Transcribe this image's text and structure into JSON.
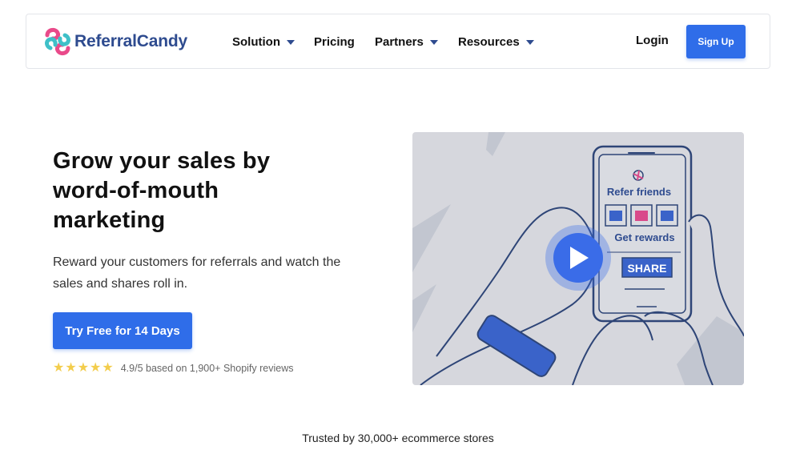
{
  "brand": {
    "name": "ReferralCandy",
    "text_color": "#2e4b8f",
    "accent": "#2f6de9"
  },
  "nav": {
    "items": [
      {
        "label": "Solution",
        "has_dropdown": true
      },
      {
        "label": "Pricing",
        "has_dropdown": false
      },
      {
        "label": "Partners",
        "has_dropdown": true
      },
      {
        "label": "Resources",
        "has_dropdown": true
      }
    ],
    "login_label": "Login",
    "signup_label": "Sign Up"
  },
  "hero": {
    "title_line1": "Grow your sales by",
    "title_line2": "word-of-mouth",
    "title_line3": "marketing",
    "subtitle": "Reward your customers for referrals and watch the sales and shares roll in.",
    "cta_label": "Try Free for 14 Days",
    "rating": {
      "stars": 5,
      "text": "4.9/5 based on 1,900+ Shopify reviews",
      "star_color": "#f3cd4c"
    }
  },
  "video": {
    "phone_heading": "Refer friends",
    "phone_subheading": "Get rewards",
    "share_label": "SHARE",
    "play_icon": "play-icon"
  },
  "trusted_text": "Trusted by 30,000+ ecommerce stores"
}
